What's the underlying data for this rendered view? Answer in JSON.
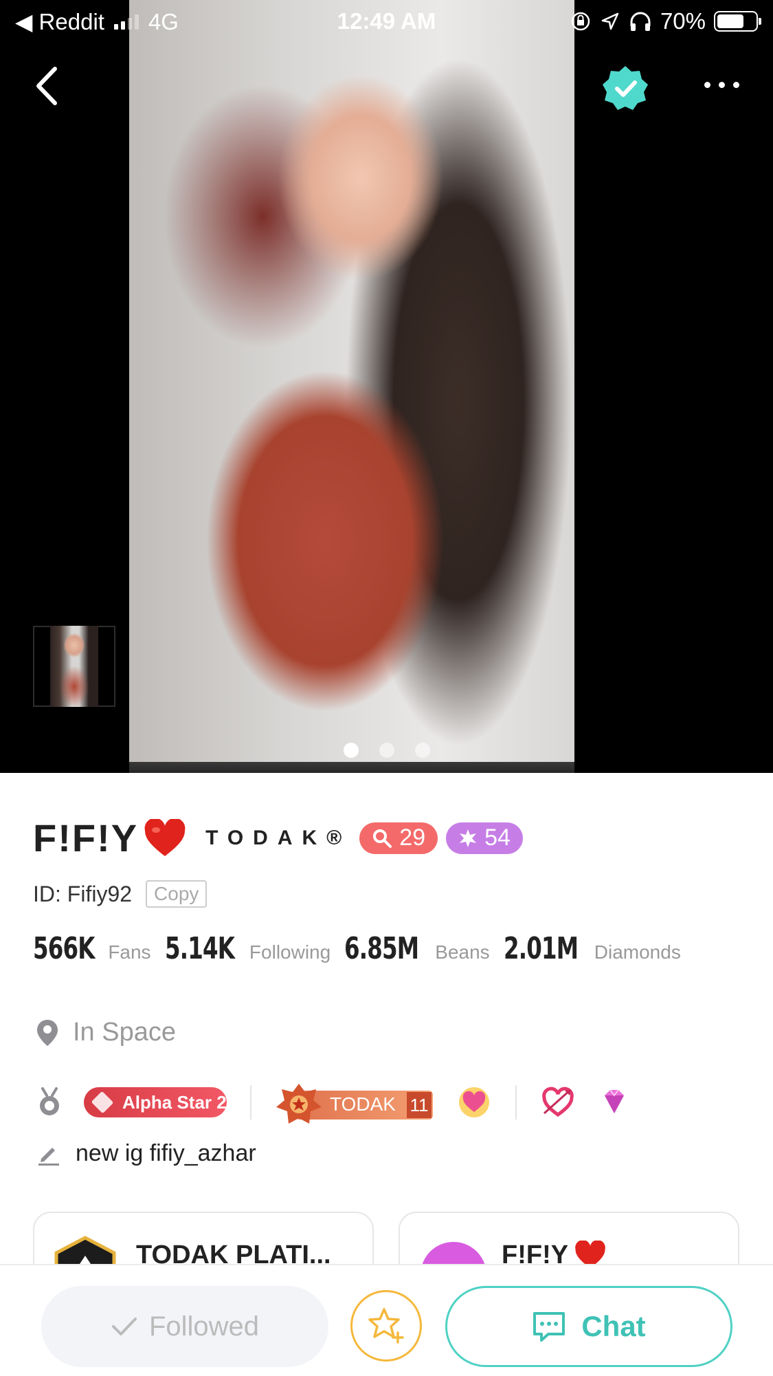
{
  "status_bar": {
    "back_app": "◀ Reddit",
    "network": "4G",
    "time": "12:49 AM",
    "battery": "70%",
    "battery_level": 0.7
  },
  "gallery": {
    "page_count": 3,
    "active_page": 1
  },
  "profile": {
    "name": "F!F!Y",
    "family": "TODAK®",
    "level_badge": "29",
    "star_badge": "54",
    "id_text": "ID: Fifiy92",
    "copy_label": "Copy",
    "stats": {
      "fans_value": "566K",
      "fans_label": "Fans",
      "following_value": "5.14K",
      "following_label": "Following",
      "beans_value": "6.85M",
      "beans_label": "Beans",
      "diamonds_value": "2.01M",
      "diamonds_label": "Diamonds"
    },
    "location": "In Space",
    "medals": {
      "alpha_label": "Alpha Star 2",
      "todak_label": "TODAK",
      "todak_level": "11"
    },
    "signature": "new ig fifiy_azhar"
  },
  "cards": {
    "left_title": "TODAK PLATI...",
    "right_title": "F!F!Y"
  },
  "actions": {
    "followed_label": "Followed",
    "chat_label": "Chat"
  },
  "colors": {
    "accent_teal": "#4fd1c4",
    "level_badge": "#f46a6a",
    "star_badge": "#c67ee6",
    "favorite_gold": "#f5b83c"
  }
}
